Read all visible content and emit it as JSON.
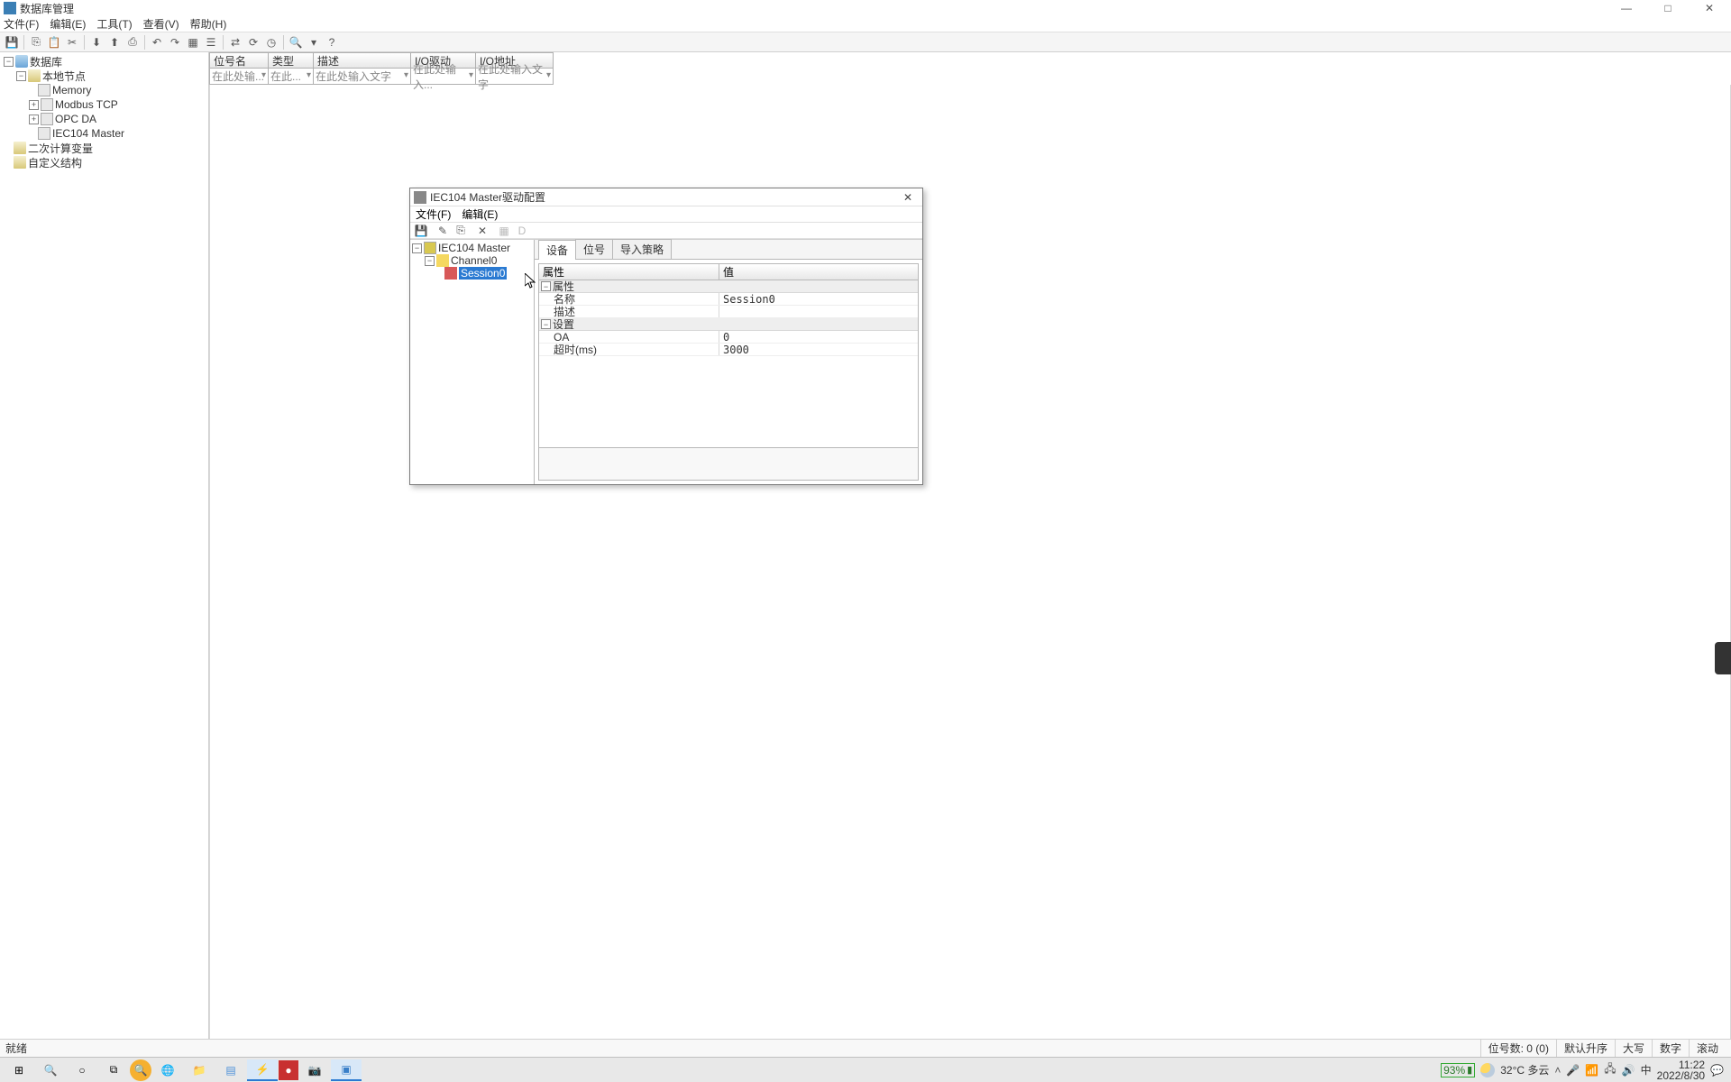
{
  "app": {
    "title": "数据库管理",
    "win_min": "—",
    "win_max": "□",
    "win_close": "✕"
  },
  "menu": {
    "file": "文件(F)",
    "edit": "编辑(E)",
    "tool": "工具(T)",
    "view": "查看(V)",
    "help": "帮助(H)"
  },
  "tree": {
    "root": "数据库",
    "local": "本地节点",
    "memory": "Memory",
    "modbus": "Modbus TCP",
    "opc": "OPC DA",
    "iec104": "IEC104 Master",
    "calc": "二次计算变量",
    "custom": "自定义结构"
  },
  "grid": {
    "col_name": "位号名",
    "col_type": "类型",
    "col_desc": "描述",
    "col_io": "I/O驱动",
    "col_addr": "I/O地址",
    "ph_name": "在此处输...",
    "ph_type": "在此...",
    "ph_desc": "在此处输入文字",
    "ph_io": "在此处输入...",
    "ph_addr": "在此处输入文字"
  },
  "dialog": {
    "title": "IEC104 Master驱动配置",
    "menu_file": "文件(F)",
    "menu_edit": "编辑(E)",
    "tb_d": "D",
    "tree_root": "IEC104 Master",
    "tree_channel": "Channel0",
    "tree_session": "Session0",
    "tab_device": "设备",
    "tab_tag": "位号",
    "tab_import": "导入策略",
    "col_prop": "属性",
    "col_val": "值",
    "group_attr": "属性",
    "row_name": "名称",
    "val_name": "Session0",
    "row_desc": "描述",
    "val_desc": "",
    "group_set": "设置",
    "row_oa": "OA",
    "val_oa": "0",
    "row_timeout": "超时(ms)",
    "val_timeout": "3000"
  },
  "status": {
    "ready": "就绪",
    "tagcount": "位号数: 0  (0)",
    "upgrade": "默认升序",
    "caps": "大写",
    "num": "数字",
    "scroll": "滚动"
  },
  "taskbar": {
    "battery": "93%",
    "temp": "32°C 多云",
    "ime": "中",
    "time": "11:22",
    "date": "2022/8/30"
  }
}
